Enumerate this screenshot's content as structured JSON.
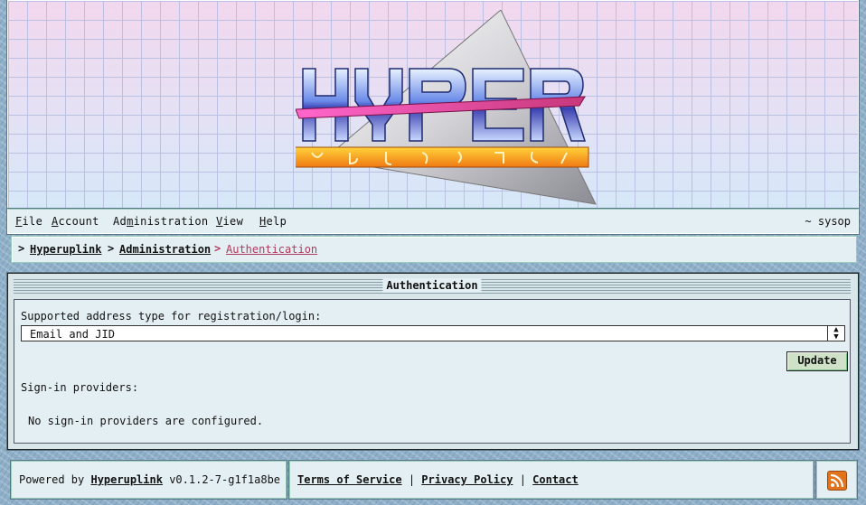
{
  "menu": {
    "items": [
      {
        "pre": "",
        "ul": "F",
        "post": "ile"
      },
      {
        "pre": "",
        "ul": "A",
        "post": "ccount"
      },
      {
        "pre": "Ad",
        "ul": "m",
        "post": "inistration"
      },
      {
        "pre": "",
        "ul": "V",
        "post": "iew"
      },
      {
        "pre": "",
        "ul": "H",
        "post": "elp"
      }
    ],
    "user": "~ sysop"
  },
  "breadcrumb": {
    "sep": ">",
    "items": [
      "Hyperuplink",
      "Administration",
      "Authentication"
    ]
  },
  "panel": {
    "title": "Authentication",
    "address_label": "Supported address type for registration/login:",
    "address_value": "Email and JID",
    "update_label": "Update",
    "signin_label": "Sign-in providers:",
    "no_providers": "No sign-in providers are configured."
  },
  "footer": {
    "powered_prefix": "Powered by",
    "powered_link": "Hyperuplink",
    "version": "v0.1.2-7-g1f1a8be",
    "links": [
      "Terms of Service",
      "Privacy Policy",
      "Contact"
    ],
    "divider": "|"
  },
  "colors": {
    "accent_current_crumb": "#b23a5c",
    "rss": "#e2731c",
    "update_button": "#cfe2c8"
  }
}
